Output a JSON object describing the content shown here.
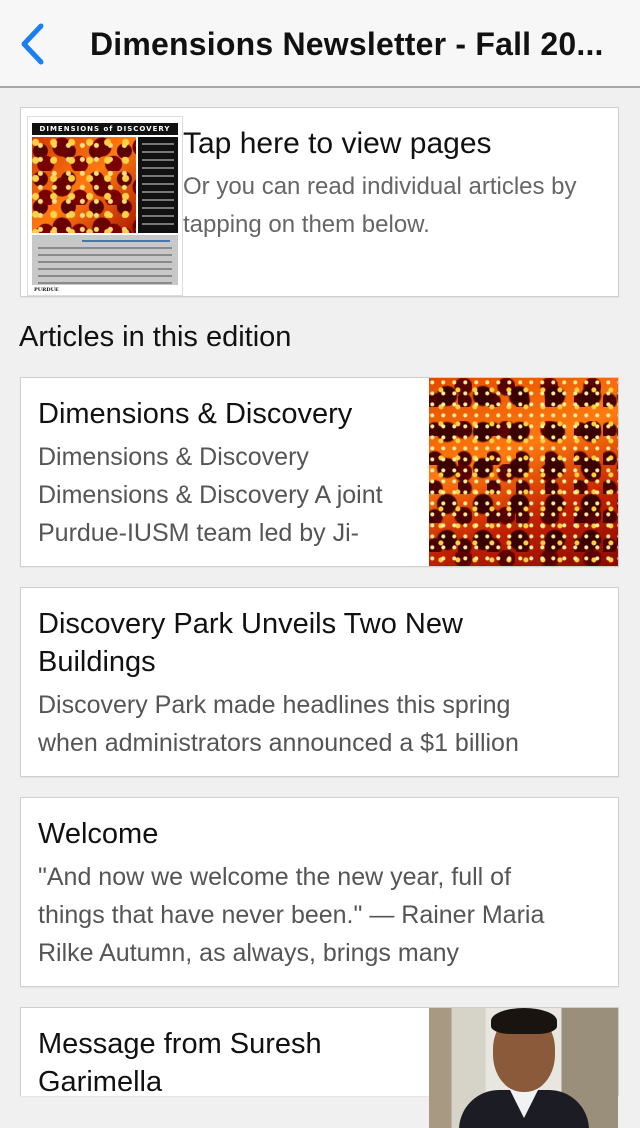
{
  "navbar": {
    "back_icon": "chevron-left-icon",
    "title": "Dimensions Newsletter - Fall 20...",
    "accent_color": "#1a7ef5"
  },
  "cover": {
    "masthead": "DIMENSIONS of DISCOVERY",
    "footer_logo": "PURDUE",
    "title": "Tap here to view pages",
    "subtitle": "Or you can read individual articles by tapping on them below."
  },
  "section_label": "Articles in this edition",
  "articles": [
    {
      "title": "Dimensions & Discovery",
      "desc_lines": [
        "Dimensions & Discovery",
        "Dimensions & Discovery A joint",
        "Purdue-IUSM team led by Ji-"
      ]
    },
    {
      "title_lines": [
        "Discovery Park Unveils Two New",
        "Buildings"
      ],
      "desc_lines": [
        "Discovery Park made headlines this spring",
        "when administrators announced a $1 billion"
      ]
    },
    {
      "title": "Welcome",
      "desc_lines": [
        "\"And now we welcome the new year, full of",
        "things that have never been.\" — Rainer Maria",
        "Rilke Autumn, as always, brings many"
      ]
    },
    {
      "title_lines": [
        "Message from Suresh",
        "Garimella"
      ]
    }
  ]
}
